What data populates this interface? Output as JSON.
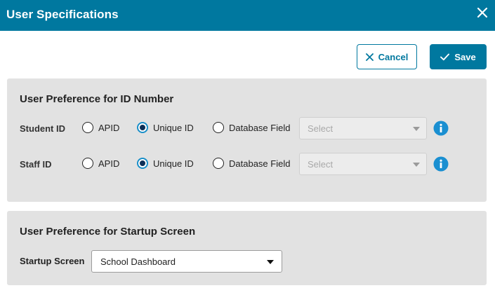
{
  "dialog": {
    "title": "User Specifications"
  },
  "toolbar": {
    "cancel_label": "Cancel",
    "save_label": "Save"
  },
  "id_preferences": {
    "heading": "User Preference for ID Number",
    "rows": [
      {
        "label": "Student ID",
        "options": [
          "APID",
          "Unique ID",
          "Database Field"
        ],
        "selected": "Unique ID",
        "field_select": {
          "value": "Select",
          "disabled": true
        }
      },
      {
        "label": "Staff ID",
        "options": [
          "APID",
          "Unique ID",
          "Database Field"
        ],
        "selected": "Unique ID",
        "field_select": {
          "value": "Select",
          "disabled": true
        }
      }
    ]
  },
  "startup_preferences": {
    "heading": "User Preference for Startup Screen",
    "label": "Startup Screen",
    "selected": "School Dashboard"
  },
  "colors": {
    "primary": "#00789f",
    "panel_bg": "#e2e2e2",
    "info_icon": "#1a8fd1",
    "radio_ring": "#1a8fc9"
  },
  "icons": {
    "close": "close-icon",
    "cancel": "x-icon",
    "save": "checkmark-icon",
    "info": "info-icon",
    "dropdown": "caret-down-icon"
  }
}
